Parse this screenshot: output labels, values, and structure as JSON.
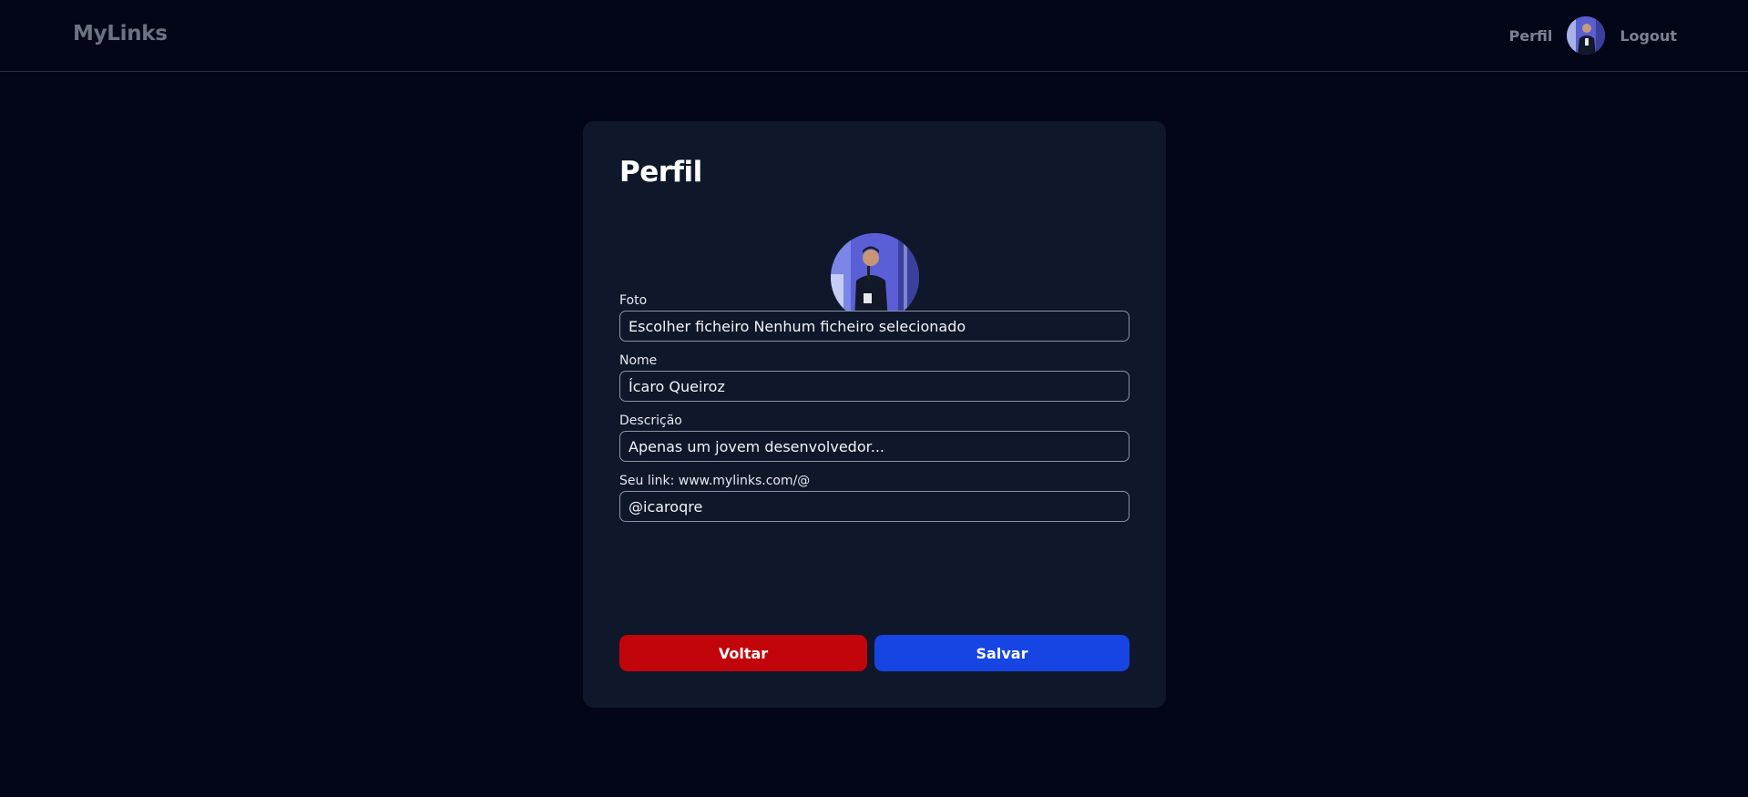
{
  "navbar": {
    "brand": "MyLinks",
    "profile_link": "Perfil",
    "logout_link": "Logout",
    "avatar_icon": "user-avatar-photo"
  },
  "card": {
    "title": "Perfil",
    "photo_icon": "user-profile-photo",
    "fields": {
      "photo": {
        "label": "Foto",
        "button_text": "Escolher ficheiro",
        "status_text": "Nenhum ficheiro selecionado"
      },
      "name": {
        "label": "Nome",
        "value": "Ícaro Queiroz"
      },
      "description": {
        "label": "Descrição",
        "value": "Apenas um jovem desenvolvedor..."
      },
      "link": {
        "label": "Seu link: www.mylinks.com/@",
        "value": "@icaroqre"
      }
    },
    "buttons": {
      "back": "Voltar",
      "save": "Salvar"
    }
  },
  "colors": {
    "background": "#030617",
    "card": "#0f172a",
    "back_button": "#c2040b",
    "save_button": "#1745e4",
    "muted_text": "#7a8292"
  }
}
